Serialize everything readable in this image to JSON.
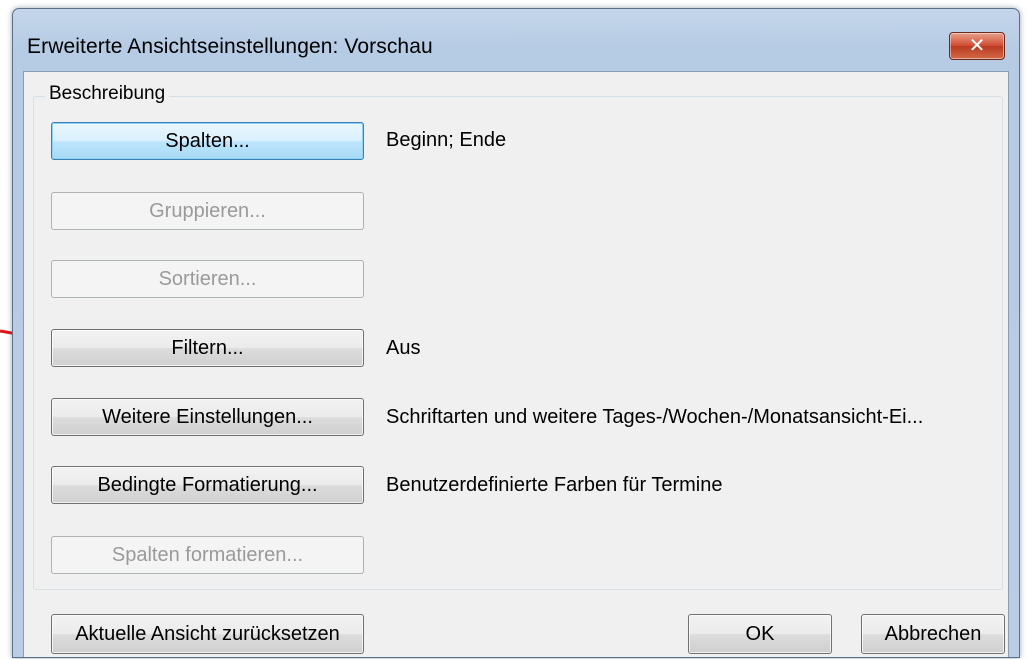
{
  "window": {
    "title": "Erweiterte Ansichtseinstellungen: Vorschau",
    "close_glyph": "✕"
  },
  "group": {
    "label": "Beschreibung"
  },
  "rows": [
    {
      "button": "Spalten...",
      "description": "Beginn; Ende",
      "enabled": true
    },
    {
      "button": "Gruppieren...",
      "description": "",
      "enabled": false
    },
    {
      "button": "Sortieren...",
      "description": "",
      "enabled": false
    },
    {
      "button": "Filtern...",
      "description": "Aus",
      "enabled": true
    },
    {
      "button": "Weitere Einstellungen...",
      "description": "Schriftarten und weitere Tages-/Wochen-/Monatsansicht-Ei...",
      "enabled": true
    },
    {
      "button": "Bedingte Formatierung...",
      "description": "Benutzerdefinierte Farben für Termine",
      "enabled": true
    },
    {
      "button": "Spalten formatieren...",
      "description": "",
      "enabled": false
    }
  ],
  "footer": {
    "reset_label": "Aktuelle Ansicht zurücksetzen",
    "ok_label": "OK",
    "cancel_label": "Abbrechen"
  },
  "annotation": {
    "arrow_color": "#e0141a"
  }
}
